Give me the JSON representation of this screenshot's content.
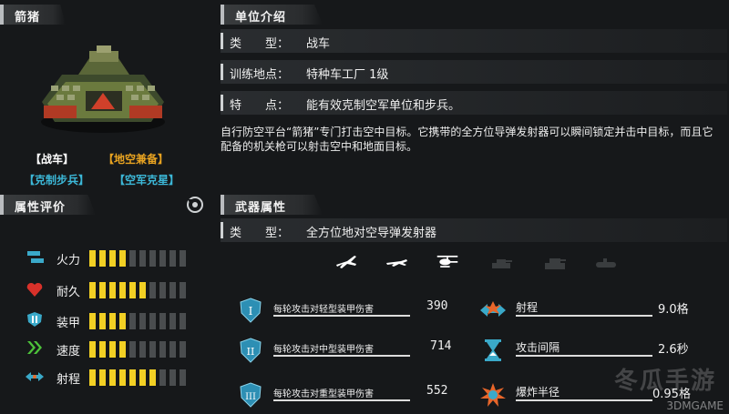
{
  "left": {
    "unit_name": "箭猪",
    "tags": [
      {
        "label": "【战车】",
        "color": "#ffffff"
      },
      {
        "label": "【地空兼备】",
        "color": "#e8a321"
      },
      {
        "label": "【克制步兵】",
        "color": "#3cb8d8"
      },
      {
        "label": "【空军克星】",
        "color": "#3cb8d8"
      }
    ],
    "attr_header": "属性评价",
    "stats": [
      {
        "label": "火力",
        "icon": "firepower-icon",
        "level": 4,
        "max": 10
      },
      {
        "label": "耐久",
        "icon": "heart-icon",
        "level": 6,
        "max": 10
      },
      {
        "label": "装甲",
        "icon": "armor-shield-icon",
        "level": 4,
        "max": 10
      },
      {
        "label": "速度",
        "icon": "speed-chevrons-icon",
        "level": 4,
        "max": 10
      },
      {
        "label": "射程",
        "icon": "range-arrows-icon",
        "level": 7,
        "max": 10
      }
    ]
  },
  "intro": {
    "header": "单位介绍",
    "rows": [
      {
        "label": "类　　型：",
        "value": "战车"
      },
      {
        "label": "训练地点：",
        "value": "特种车工厂 1级"
      },
      {
        "label": "特　　点：",
        "value": "能有效克制空军单位和步兵。"
      }
    ],
    "description": "自行防空平台“箭猪”专门打击空中目标。它携带的全方位导弹发射器可以瞬间锁定并击中目标，而且它配备的机关枪可以射击空中和地面目标。"
  },
  "weapon": {
    "header": "武器属性",
    "type_label": "类　　型：",
    "type_value": "全方位地对空导弹发射器",
    "targets": [
      {
        "icon": "fighter-jet-icon",
        "active": true
      },
      {
        "icon": "bomber-plane-icon",
        "active": true
      },
      {
        "icon": "helicopter-icon",
        "active": true
      },
      {
        "icon": "light-tank-icon",
        "active": false
      },
      {
        "icon": "heavy-tank-icon",
        "active": false
      },
      {
        "icon": "infantry-icon",
        "active": false
      }
    ],
    "damage": [
      {
        "badge": "I",
        "label": "每轮攻击对轻型装甲伤害",
        "value": "390"
      },
      {
        "badge": "II",
        "label": "每轮攻击对中型装甲伤害",
        "value": "714"
      },
      {
        "badge": "III",
        "label": "每轮攻击对重型装甲伤害",
        "value": "552"
      }
    ],
    "specs": [
      {
        "icon": "range-arrows-icon",
        "label": "射程",
        "value": "9.0格"
      },
      {
        "icon": "hourglass-icon",
        "label": "攻击间隔",
        "value": "2.6秒"
      },
      {
        "icon": "explosion-radius-icon",
        "label": "爆炸半径",
        "value": "0.95格"
      }
    ]
  },
  "watermark": {
    "main": "冬瓜手游",
    "sub": "3DMGAME"
  },
  "colors": {
    "bar_on": "#f2d024",
    "bar_off": "#4a4d4f",
    "accent_blue": "#3cb8d8",
    "accent_orange": "#e8a321"
  }
}
